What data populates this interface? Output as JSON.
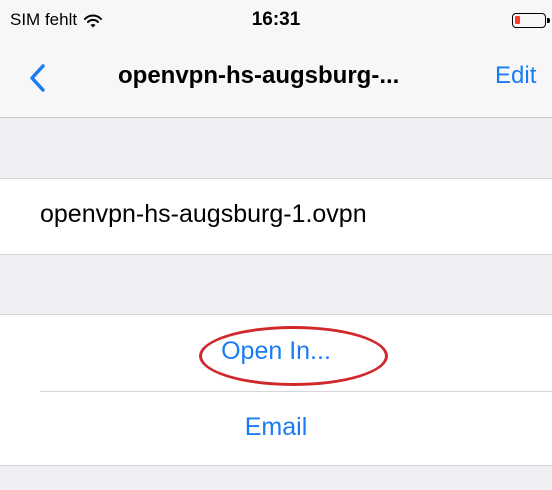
{
  "status_bar": {
    "carrier": "SIM fehlt",
    "wifi_icon": "wifi-icon",
    "time": "16:31",
    "battery_icon": "battery-low-icon",
    "battery_color": "#ff3b30"
  },
  "nav_bar": {
    "back_icon": "chevron-left-icon",
    "title": "openvpn-hs-augsburg-...",
    "edit_label": "Edit"
  },
  "file": {
    "name": "openvpn-hs-augsburg-1.ovpn"
  },
  "actions": [
    {
      "label": "Open In..."
    },
    {
      "label": "Email"
    }
  ],
  "colors": {
    "accent": "#1a7cf5",
    "annotation_ring": "#d0282b",
    "background": "#efeff4"
  }
}
